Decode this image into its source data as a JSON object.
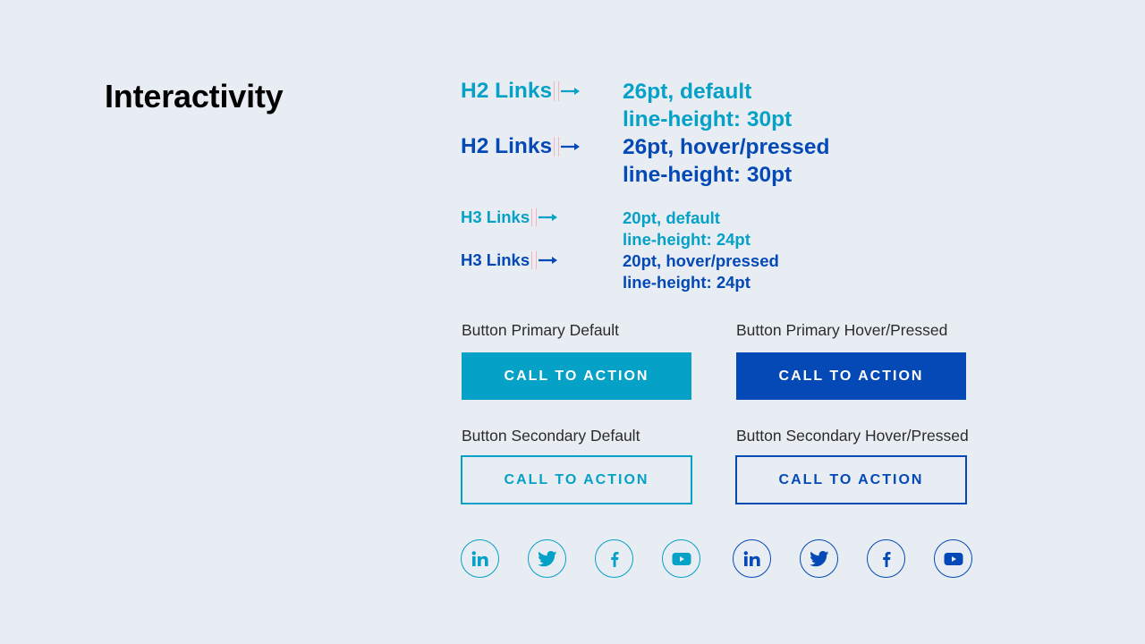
{
  "page": {
    "title": "Interactivity",
    "colors": {
      "background": "#e8edf4",
      "default": "#05a1c6",
      "hover_pressed": "#0449b6",
      "label_text": "#2b2b2b",
      "guide_line": "#f4b3b8"
    }
  },
  "links": [
    {
      "label": "H2 Links",
      "state": "default",
      "arrow_icon": "arrow-right-icon",
      "spec_lines": [
        "26pt, default",
        "line-height: 30pt"
      ]
    },
    {
      "label": "H2 Links",
      "state": "hover/pressed",
      "arrow_icon": "arrow-right-icon",
      "spec_lines": [
        "26pt, hover/pressed",
        "line-height: 30pt"
      ]
    },
    {
      "label": "H3 Links",
      "state": "default",
      "arrow_icon": "arrow-right-icon",
      "spec_lines": [
        "20pt, default",
        "line-height: 24pt"
      ]
    },
    {
      "label": "H3 Links",
      "state": "hover/pressed",
      "arrow_icon": "arrow-right-icon",
      "spec_lines": [
        "20pt, hover/pressed",
        "line-height: 24pt"
      ]
    }
  ],
  "buttons": [
    {
      "caption": "Button Primary Default",
      "label": "CALL TO ACTION"
    },
    {
      "caption": "Button Primary Hover/Pressed",
      "label": "CALL TO ACTION"
    },
    {
      "caption": "Button Secondary Default",
      "label": "CALL TO ACTION"
    },
    {
      "caption": "Button Secondary Hover/Pressed",
      "label": "CALL TO ACTION"
    }
  ],
  "social_icons": {
    "default": [
      "linkedin-icon",
      "twitter-icon",
      "facebook-icon",
      "youtube-icon"
    ],
    "hover_pressed": [
      "linkedin-icon",
      "twitter-icon",
      "facebook-icon",
      "youtube-icon"
    ]
  }
}
